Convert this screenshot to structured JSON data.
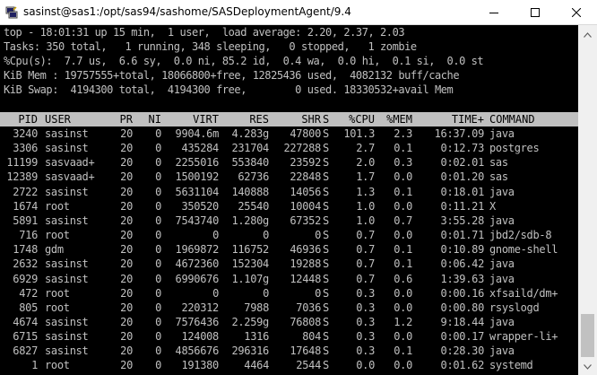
{
  "window": {
    "title": "sasinst@sas1:/opt/sas94/sashome/SASDeploymentAgent/9.4"
  },
  "summary": [
    "top - 18:01:31 up 15 min,  1 user,  load average: 2.20, 2.37, 2.03",
    "Tasks: 350 total,   1 running, 348 sleeping,   0 stopped,   1 zombie",
    "%Cpu(s):  7.7 us,  6.6 sy,  0.0 ni, 85.2 id,  0.4 wa,  0.0 hi,  0.1 si,  0.0 st",
    "KiB Mem : 19757555+total, 18066800+free, 12825436 used,  4082132 buff/cache",
    "KiB Swap:  4194300 total,  4194300 free,        0 used. 18330532+avail Mem"
  ],
  "table": {
    "headers": [
      "PID",
      "USER",
      "PR",
      "NI",
      "VIRT",
      "RES",
      "SHR",
      "S",
      "%CPU",
      "%MEM",
      "TIME+",
      "COMMAND"
    ],
    "rows": [
      [
        "3240",
        "sasinst",
        "20",
        "0",
        "9904.6m",
        "4.283g",
        "47800",
        "S",
        "101.3",
        "2.3",
        "16:37.09",
        "java"
      ],
      [
        "3306",
        "sasinst",
        "20",
        "0",
        "435284",
        "231704",
        "227288",
        "S",
        "2.7",
        "0.1",
        "0:12.73",
        "postgres"
      ],
      [
        "11199",
        "sasvaad+",
        "20",
        "0",
        "2255016",
        "553840",
        "23592",
        "S",
        "2.0",
        "0.3",
        "0:02.01",
        "sas"
      ],
      [
        "12389",
        "sasvaad+",
        "20",
        "0",
        "1500192",
        "62736",
        "22848",
        "S",
        "1.7",
        "0.0",
        "0:01.20",
        "sas"
      ],
      [
        "2722",
        "sasinst",
        "20",
        "0",
        "5631104",
        "140888",
        "14056",
        "S",
        "1.3",
        "0.1",
        "0:18.01",
        "java"
      ],
      [
        "1674",
        "root",
        "20",
        "0",
        "350520",
        "25540",
        "10004",
        "S",
        "1.0",
        "0.0",
        "0:11.21",
        "X"
      ],
      [
        "5891",
        "sasinst",
        "20",
        "0",
        "7543740",
        "1.280g",
        "67352",
        "S",
        "1.0",
        "0.7",
        "3:55.28",
        "java"
      ],
      [
        "716",
        "root",
        "20",
        "0",
        "0",
        "0",
        "0",
        "S",
        "0.7",
        "0.0",
        "0:01.71",
        "jbd2/sdb-8"
      ],
      [
        "1748",
        "gdm",
        "20",
        "0",
        "1969872",
        "116752",
        "46936",
        "S",
        "0.7",
        "0.1",
        "0:10.89",
        "gnome-shell"
      ],
      [
        "2632",
        "sasinst",
        "20",
        "0",
        "4672360",
        "152304",
        "19288",
        "S",
        "0.7",
        "0.1",
        "0:06.42",
        "java"
      ],
      [
        "6929",
        "sasinst",
        "20",
        "0",
        "6990676",
        "1.107g",
        "12448",
        "S",
        "0.7",
        "0.6",
        "1:39.63",
        "java"
      ],
      [
        "472",
        "root",
        "20",
        "0",
        "0",
        "0",
        "0",
        "S",
        "0.3",
        "0.0",
        "0:00.16",
        "xfsaild/dm+"
      ],
      [
        "805",
        "root",
        "20",
        "0",
        "220312",
        "7988",
        "7036",
        "S",
        "0.3",
        "0.0",
        "0:00.80",
        "rsyslogd"
      ],
      [
        "4674",
        "sasinst",
        "20",
        "0",
        "7576436",
        "2.259g",
        "76808",
        "S",
        "0.3",
        "1.2",
        "9:18.44",
        "java"
      ],
      [
        "6715",
        "sasinst",
        "20",
        "0",
        "124008",
        "1316",
        "804",
        "S",
        "0.3",
        "0.0",
        "0:00.17",
        "wrapper-li+"
      ],
      [
        "6827",
        "sasinst",
        "20",
        "0",
        "4856676",
        "296316",
        "17648",
        "S",
        "0.3",
        "0.1",
        "0:28.30",
        "java"
      ],
      [
        "1",
        "root",
        "20",
        "0",
        "191380",
        "4464",
        "2544",
        "S",
        "0.0",
        "0.0",
        "0:01.62",
        "systemd"
      ]
    ]
  },
  "colors": {
    "terminal_bg": "#000000",
    "terminal_fg": "#c0c0c0",
    "header_bg": "#c0c0c0",
    "titlebar_bg": "#ffffff"
  }
}
